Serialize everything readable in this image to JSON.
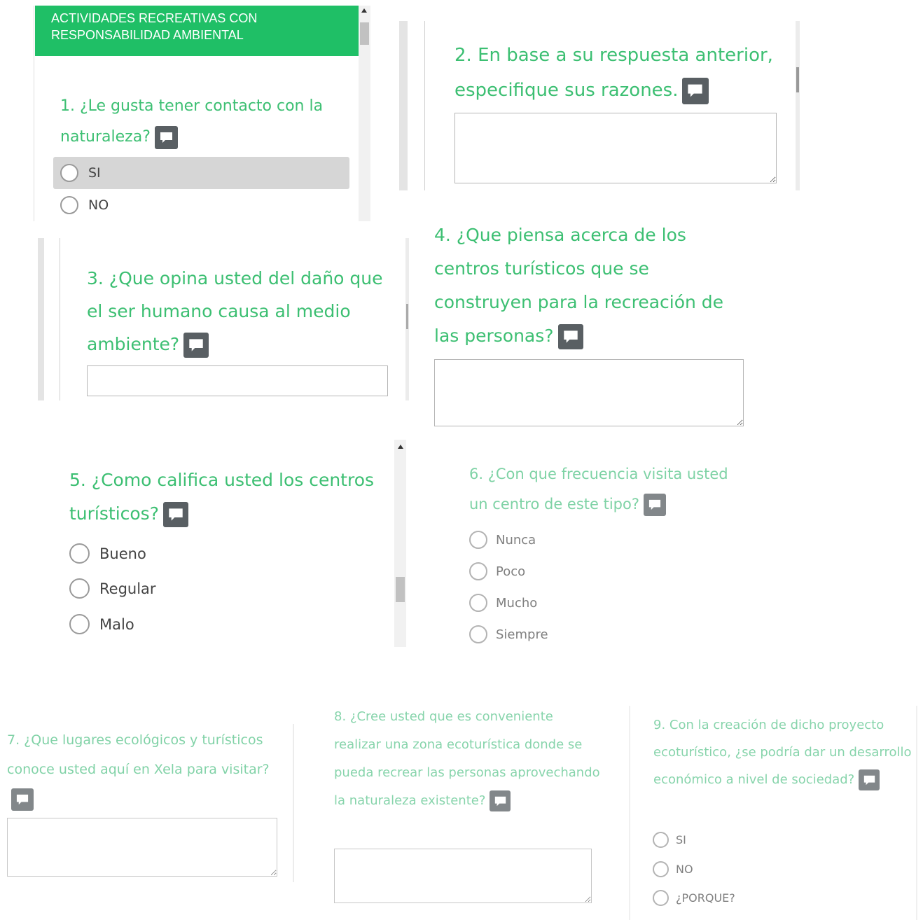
{
  "panel1": {
    "header": "ACTIVIDADES RECREATIVAS CON RESPONSABILIDAD AMBIENTAL",
    "header_color": "#1fbf66",
    "question": "1. ¿Le gusta tener contacto con la naturaleza?",
    "options": [
      "SI",
      "NO"
    ]
  },
  "panel2": {
    "question": "2. En base a su respuesta anterior, especifique sus razones."
  },
  "panel3": {
    "question": "3. ¿Que opina usted del daño que el ser humano causa al medio ambiente?"
  },
  "panel4": {
    "question": "4. ¿Que piensa acerca de los centros turísticos que se construyen para la recreación de las personas?"
  },
  "panel5": {
    "question": "5. ¿Como califica usted los centros turísticos?",
    "options": [
      "Bueno",
      "Regular",
      "Malo"
    ]
  },
  "panel6": {
    "question": "6. ¿Con que frecuencia visita usted un centro de este tipo?",
    "options": [
      "Nunca",
      "Poco",
      "Mucho",
      "Siempre"
    ]
  },
  "panel7": {
    "question": "7. ¿Que lugares ecológicos y turísticos conoce usted aquí en Xela para visitar?"
  },
  "panel8": {
    "question": "8. ¿Cree usted que es conveniente realizar una zona ecoturística donde se pueda recrear las personas aprovechando la naturaleza existente?"
  },
  "panel9": {
    "question": "9. Con la creación de dicho proyecto ecoturístico, ¿se podría dar un desarrollo económico a nivel de sociedad?",
    "options": [
      "SI",
      "NO",
      "¿PORQUE?"
    ]
  },
  "icons": {
    "comment": "comment-icon",
    "radio": "radio-icon"
  }
}
